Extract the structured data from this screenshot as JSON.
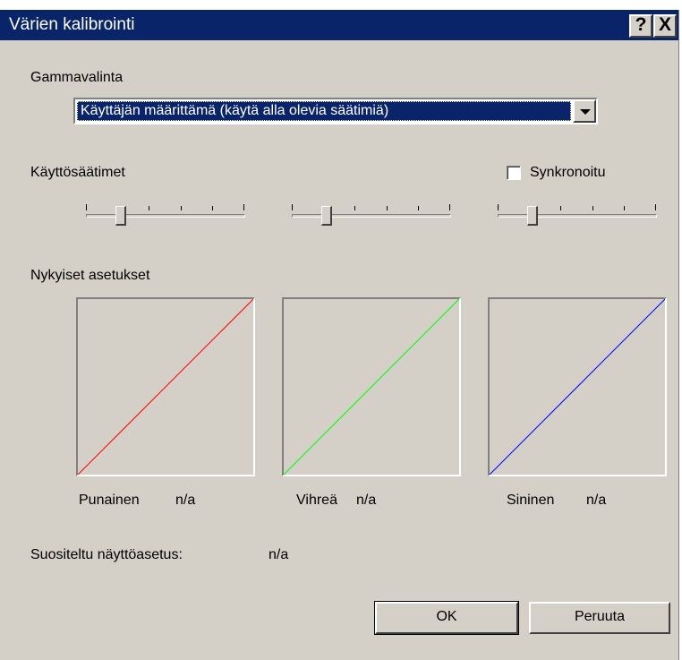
{
  "window": {
    "title": "Värien kalibrointi",
    "help_button": "?",
    "close_button": "X"
  },
  "gamma": {
    "label": "Gammavalinta",
    "selected": "Käyttäjän määrittämä (käytä alla olevia säätimiä)"
  },
  "controls": {
    "label": "Käyttösäätimet",
    "synchronized_label": "Synkronoitu",
    "synchronized_checked": false,
    "sliders": [
      {
        "name": "red-slider",
        "ticks": 6,
        "position_fraction": 0.2
      },
      {
        "name": "green-slider",
        "ticks": 6,
        "position_fraction": 0.2
      },
      {
        "name": "blue-slider",
        "ticks": 6,
        "position_fraction": 0.2
      }
    ]
  },
  "current": {
    "label": "Nykyiset asetukset",
    "channels": [
      {
        "name": "Punainen",
        "value": "n/a",
        "color": "#ff0000"
      },
      {
        "name": "Vihreä",
        "value": "n/a",
        "color": "#00ff00"
      },
      {
        "name": "Sininen",
        "value": "n/a",
        "color": "#0000ff"
      }
    ]
  },
  "recommended": {
    "label": "Suositeltu näyttöasetus:",
    "value": "n/a"
  },
  "buttons": {
    "ok": "OK",
    "cancel": "Peruuta"
  },
  "colors": {
    "titlebar": "#0a246a",
    "dialog_bg": "#d4d0c8"
  }
}
